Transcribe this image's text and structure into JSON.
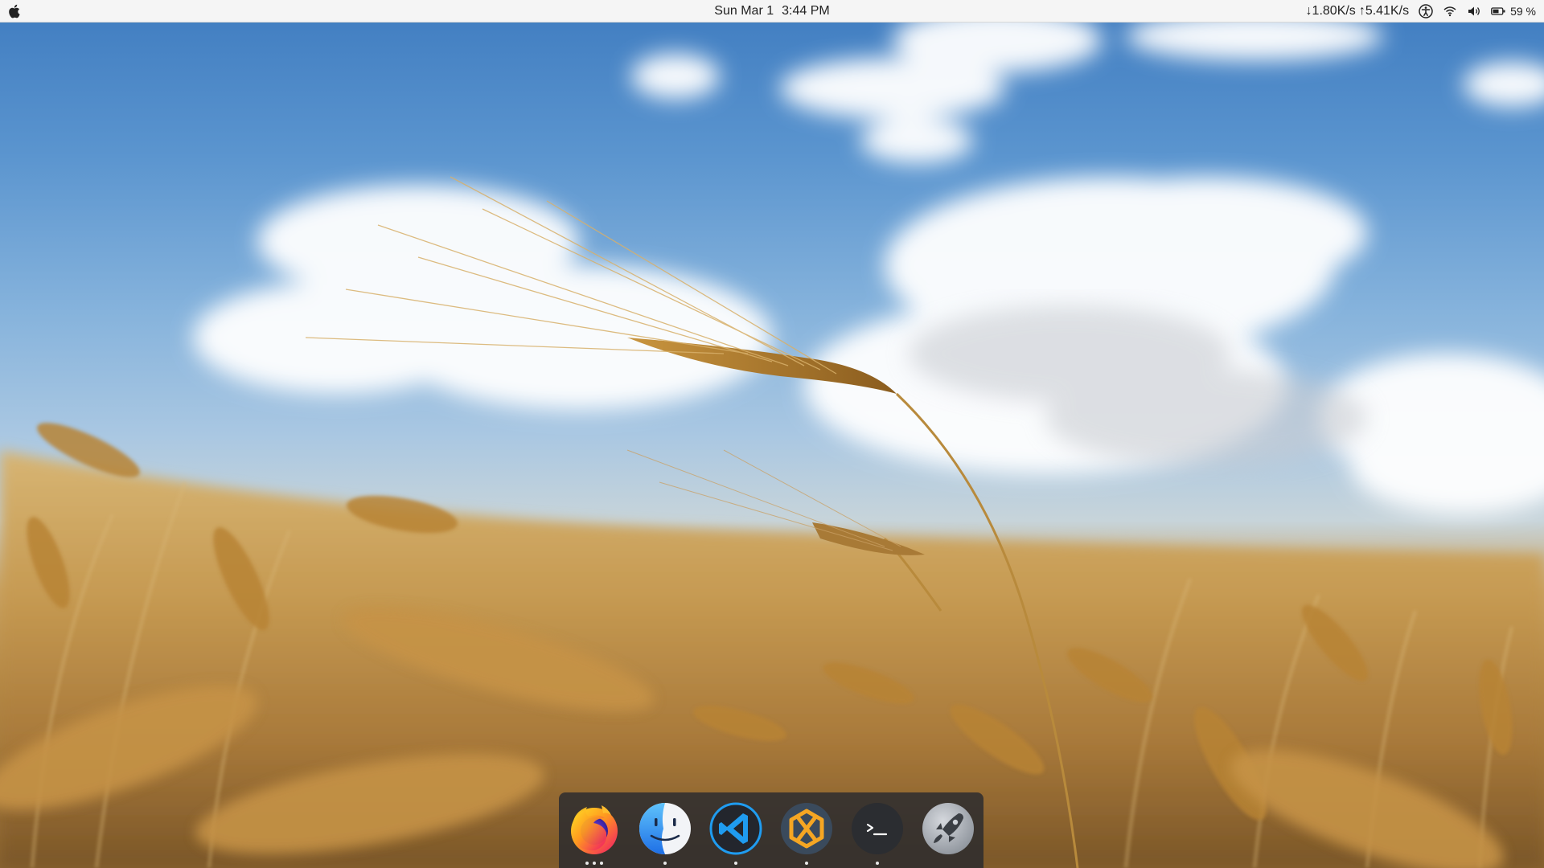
{
  "topbar": {
    "date": "Sun Mar 1",
    "time": "3:44 PM",
    "net_down": "↓1.80K/s",
    "net_up": "↑5.41K/s",
    "battery_percent": "59 %",
    "icons": [
      "apple-icon",
      "accessibility-icon",
      "wifi-icon",
      "volume-icon",
      "battery-icon"
    ]
  },
  "dock": {
    "items": [
      {
        "name": "Firefox",
        "icon": "firefox-icon",
        "running_windows": 3
      },
      {
        "name": "Finder",
        "icon": "finder-icon",
        "running_windows": 1
      },
      {
        "name": "Visual Studio Code",
        "icon": "vscode-icon",
        "running_windows": 1
      },
      {
        "name": "Hexchat",
        "icon": "hexchat-icon",
        "running_windows": 1
      },
      {
        "name": "Terminal",
        "icon": "terminal-icon",
        "running_windows": 1
      },
      {
        "name": "Launchpad",
        "icon": "launchpad-icon",
        "running_windows": 0
      }
    ]
  },
  "wallpaper": {
    "subject": "wheat-field-under-blue-sky"
  },
  "colors": {
    "topbar_bg": "#f5f5f5",
    "dock_bg": "rgba(40,42,46,0.82)",
    "sky": "#4a86c6",
    "wheat": "#c08a3e"
  }
}
